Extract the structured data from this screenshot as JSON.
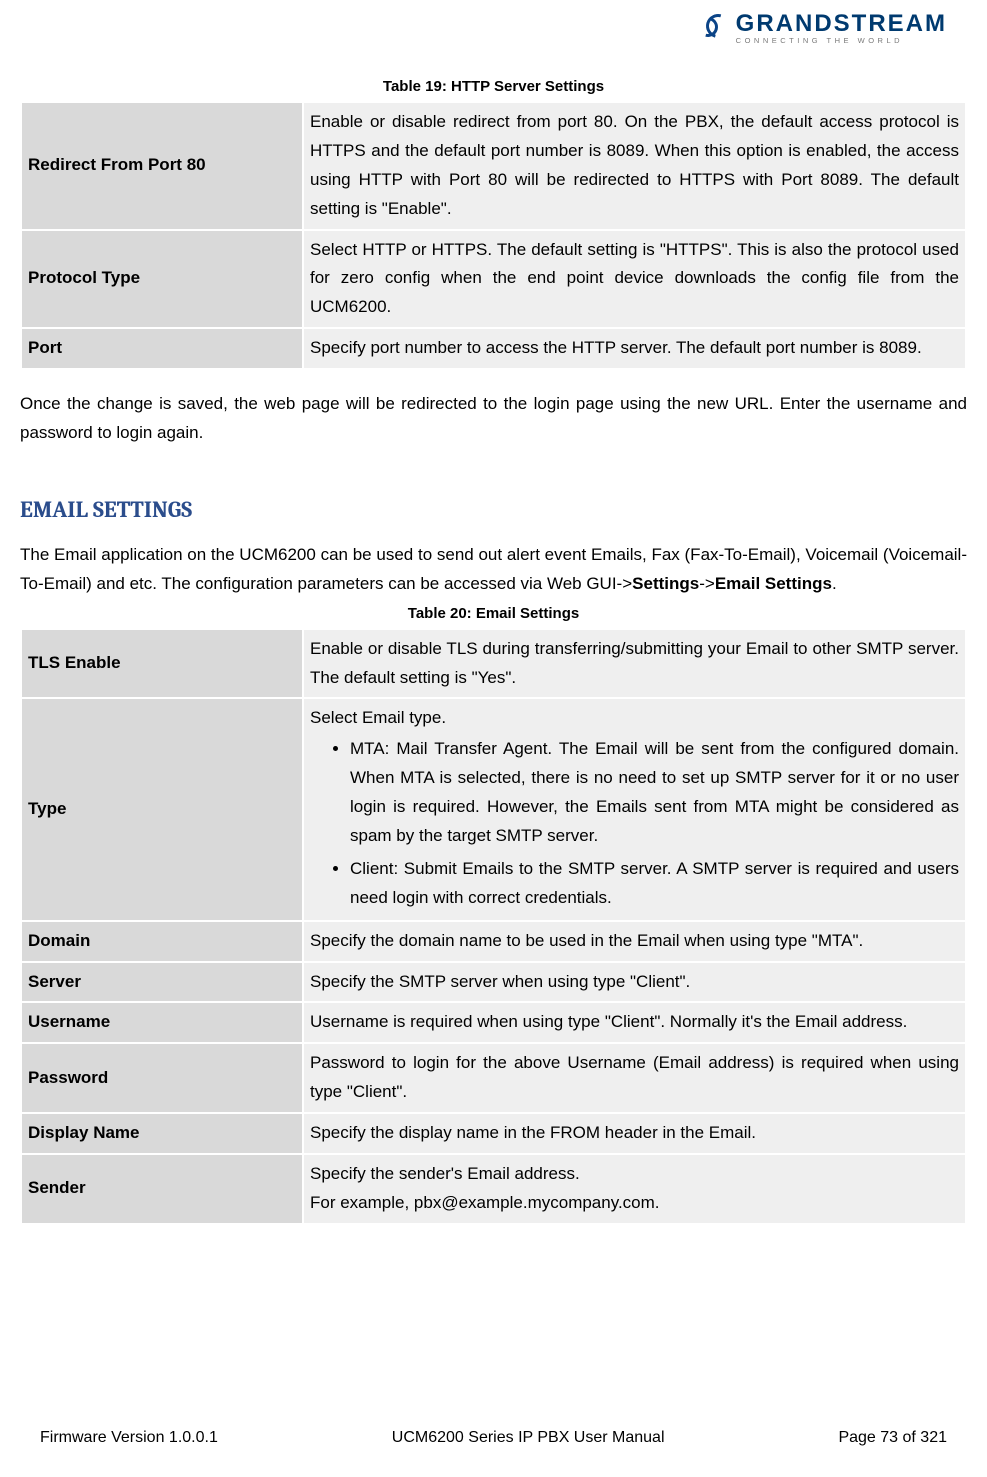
{
  "logo": {
    "brand": "GRANDSTREAM",
    "tagline": "CONNECTING THE WORLD"
  },
  "table19": {
    "caption": "Table 19: HTTP Server Settings",
    "rows": [
      {
        "label": "Redirect From Port 80",
        "desc": "Enable or disable redirect from port 80. On the PBX, the default access protocol is HTTPS and the default port number is 8089. When this option is enabled, the access using HTTP with Port 80 will be redirected to HTTPS with Port 8089. The default setting is \"Enable\"."
      },
      {
        "label": "Protocol Type",
        "desc": "Select HTTP or HTTPS. The default setting is \"HTTPS\". This is also the protocol used for zero config when the end point device downloads the config file from the UCM6200."
      },
      {
        "label": "Port",
        "desc": "Specify port number to access the HTTP server. The default port number is 8089."
      }
    ]
  },
  "para1": "Once the change is saved, the web page will be redirected to the login page using the new URL. Enter the username and password to login again.",
  "heading": "EMAIL SETTINGS",
  "para2_leading": "The Email application on the UCM6200 can be used to send out alert event Emails, Fax (Fax-To-Email), Voicemail (Voicemail-To-Email) and etc. The configuration parameters can be accessed via Web GUI->",
  "para2_bold1": "Settings",
  "para2_mid": "->",
  "para2_bold2": "Email Settings",
  "para2_end": ".",
  "table20": {
    "caption": "Table 20: Email Settings",
    "rows": {
      "tls_label": "TLS Enable",
      "tls_desc": "Enable or disable TLS during transferring/submitting your Email to other SMTP server. The default setting is \"Yes\".",
      "type_label": "Type",
      "type_intro": "Select Email type.",
      "type_b1": "MTA: Mail Transfer Agent. The Email will be sent from the configured domain. When MTA is selected, there is no need to set up SMTP server for it or no user login is required. However, the Emails sent from MTA might be considered as spam by the target SMTP server.",
      "type_b2": "Client: Submit Emails to the SMTP server. A SMTP server is required and users need login with correct credentials.",
      "domain_label": "Domain",
      "domain_desc": "Specify the domain name to be used in the Email when using type \"MTA\".",
      "server_label": "Server",
      "server_desc": "Specify the SMTP server when using type \"Client\".",
      "user_label": "Username",
      "user_desc": "Username is required when using type \"Client\". Normally it's the Email address.",
      "pass_label": "Password",
      "pass_desc": "Password to login for the above Username (Email address) is required when using type \"Client\".",
      "disp_label": "Display Name",
      "disp_desc": "Specify the display name in the FROM header in the Email.",
      "sender_label": "Sender",
      "sender_l1": "Specify the sender's Email address.",
      "sender_l2": "For example, pbx@example.mycompany.com."
    }
  },
  "footer": {
    "left": "Firmware Version 1.0.0.1",
    "center": "UCM6200 Series IP PBX User Manual",
    "right": "Page 73 of 321"
  }
}
